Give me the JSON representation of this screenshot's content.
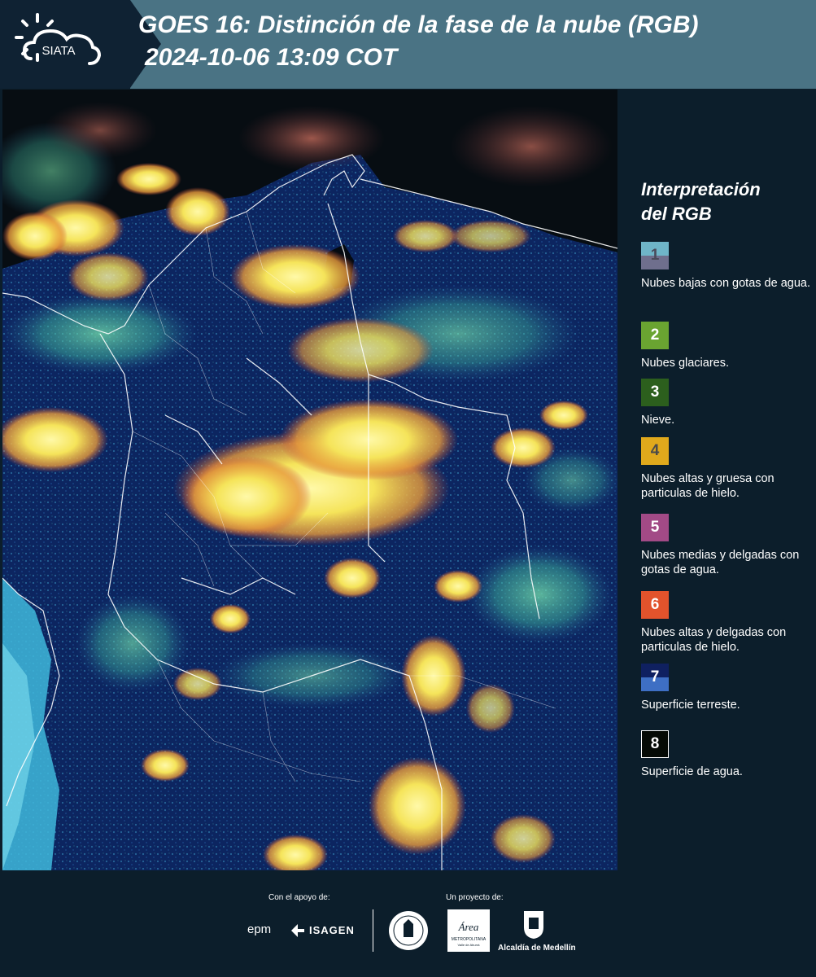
{
  "header": {
    "logo_text": "SIATA",
    "title_line1": "GOES 16: Distinción de la fase de la nube (RGB)",
    "title_line2": "2024-10-06 13:09 COT"
  },
  "legend": {
    "title_line1": "Interpretación",
    "title_line2": "del RGB",
    "items": [
      {
        "number": "1",
        "label": "Nubes bajas con gotas de agua.",
        "color_top": "#6fb5c8",
        "color_bottom": "#6f6f8d",
        "text_color": "#4a4a5a"
      },
      {
        "number": "2",
        "label": "Nubes glaciares.",
        "color_top": "#6aa431",
        "color_bottom": "#6aa431",
        "text_color": "#ffffff"
      },
      {
        "number": "3",
        "label": "Nieve.",
        "color_top": "#2c5f1d",
        "color_bottom": "#2c5f1d",
        "text_color": "#ffffff"
      },
      {
        "number": "4",
        "label": "Nubes altas y gruesa con particulas de hielo.",
        "color_top": "#e0a91c",
        "color_bottom": "#e0a91c",
        "text_color": "#4a4a4a"
      },
      {
        "number": "5",
        "label": "Nubes medias y delgadas con gotas de agua.",
        "color_top": "#a24a86",
        "color_bottom": "#a24a86",
        "text_color": "#ffffff"
      },
      {
        "number": "6",
        "label": "Nubes altas y delgadas con particulas de hielo.",
        "color_top": "#e2532c",
        "color_bottom": "#e2532c",
        "text_color": "#ffffff"
      },
      {
        "number": "7",
        "label": "Superficie terreste.",
        "color_top": "#0f2060",
        "color_bottom": "#3e6fc4",
        "text_color": "#ffffff"
      },
      {
        "number": "8",
        "label": "Superficie de agua.",
        "color_top": "#050a05",
        "color_bottom": "#050a05",
        "text_color": "#ffffff"
      }
    ]
  },
  "footer": {
    "support_label": "Con el apoyo de:",
    "project_label": "Un proyecto de:",
    "epm_text": "epm",
    "isagen_text": "ISAGEN",
    "area_text": "Área",
    "area_sub": "METROPOLITANA",
    "area_sub2": "Valle de Aburrá",
    "alcaldia_text": "Alcaldía de Medellín"
  }
}
